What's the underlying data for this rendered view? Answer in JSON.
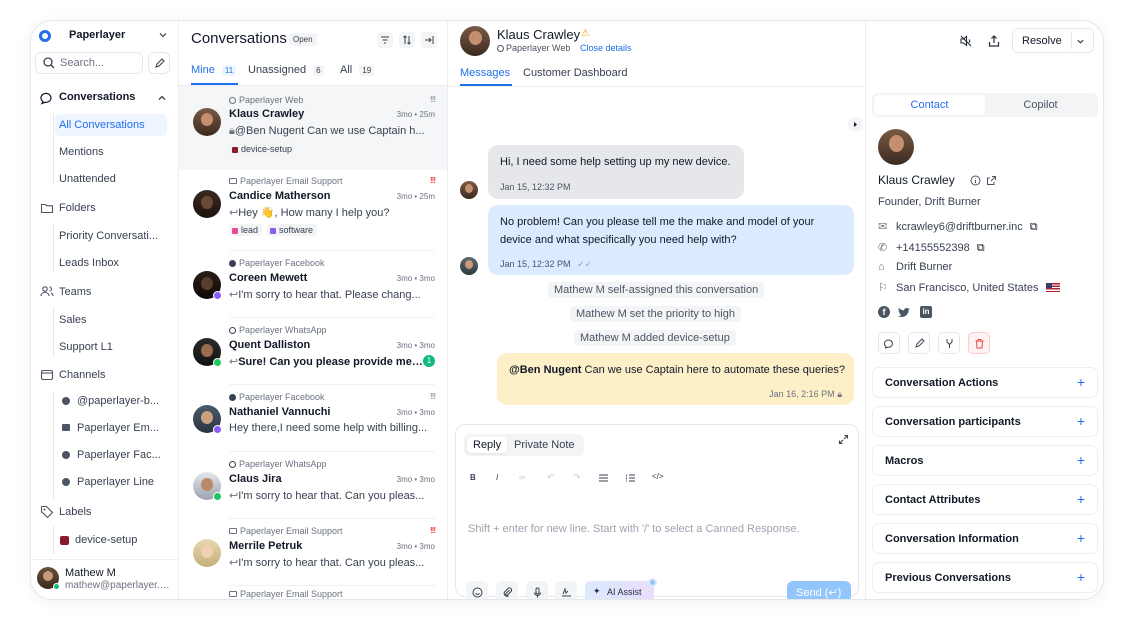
{
  "sidebar": {
    "workspace": "Paperlayer",
    "search_placeholder": "Search...",
    "conversations_label": "Conversations",
    "conv_items": [
      "All Conversations",
      "Mentions",
      "Unattended"
    ],
    "folders_label": "Folders",
    "folder_items": [
      "Priority Conversati...",
      "Leads Inbox"
    ],
    "teams_label": "Teams",
    "team_items": [
      "Sales",
      "Support L1"
    ],
    "channels_label": "Channels",
    "channel_items": [
      "@paperlayer-b...",
      "Paperlayer Em...",
      "Paperlayer Fac...",
      "Paperlayer Line"
    ],
    "labels_label": "Labels",
    "label_items": [
      {
        "name": "device-setup",
        "color": "#8b1a2b"
      }
    ],
    "user": {
      "name": "Mathew M",
      "email": "mathew@paperlayer.c..."
    }
  },
  "list": {
    "title": "Conversations",
    "status_badge": "Open",
    "tabs": [
      {
        "label": "Mine",
        "count": "11"
      },
      {
        "label": "Unassigned",
        "count": "6"
      },
      {
        "label": "All",
        "count": "19"
      }
    ],
    "items": [
      {
        "source": "Paperlayer Web",
        "name": "Klaus Crawley",
        "time": "3mo • 25m",
        "preview": "@Ben Nugent Can we use Captain h...",
        "tags": [
          {
            "name": "device-setup",
            "color": "#8b1a2b"
          }
        ],
        "priority": "!!!"
      },
      {
        "source": "Paperlayer Email Support",
        "name": "Candice Matherson",
        "time": "3mo • 25m",
        "preview": "Hey 👋, How many I help you?",
        "tags": [
          {
            "name": "lead",
            "color": "#ec4899"
          },
          {
            "name": "software",
            "color": "#8b5cf6"
          }
        ],
        "priority": "!!!"
      },
      {
        "source": "Paperlayer Facebook",
        "name": "Coreen Mewett",
        "time": "3mo • 3mo",
        "preview": "I'm sorry to hear that. Please chang..."
      },
      {
        "source": "Paperlayer WhatsApp",
        "name": "Quent Dalliston",
        "time": "3mo • 3mo",
        "preview": "Sure! Can you please provide me wi...",
        "unread": "1"
      },
      {
        "source": "Paperlayer Facebook",
        "name": "Nathaniel Vannuchi",
        "time": "3mo • 3mo",
        "preview": "Hey there,I need some help with billing...",
        "priority": "!!!"
      },
      {
        "source": "Paperlayer WhatsApp",
        "name": "Claus Jira",
        "time": "3mo • 3mo",
        "preview": "I'm sorry to hear that. Can you pleas..."
      },
      {
        "source": "Paperlayer Email Support",
        "name": "Merrile Petruk",
        "time": "3mo • 3mo",
        "preview": "I'm sorry to hear that. Can you pleas...",
        "priority": "!!!"
      },
      {
        "source": "Paperlayer Email Support"
      }
    ]
  },
  "chat": {
    "contact_name": "Klaus Crawley",
    "inbox": "Paperlayer Web",
    "close_details": "Close details",
    "resolve_label": "Resolve",
    "tabs": [
      "Messages",
      "Customer Dashboard"
    ],
    "messages": [
      {
        "text": "Hi, I need some help setting up my new device.",
        "time": "Jan 15, 12:32 PM"
      },
      {
        "text": "No problem! Can you please tell me the make and model of your device and what specifically you need help with?",
        "time": "Jan 15, 12:32 PM"
      }
    ],
    "activities": [
      "Mathew M self-assigned this conversation",
      "Mathew M set the priority to high",
      "Mathew M added device-setup"
    ],
    "private_note": {
      "mention": "@Ben Nugent",
      "text": " Can we use Captain here to automate these queries?",
      "time": "Jan 16, 2:16 PM"
    },
    "composer": {
      "tab_reply": "Reply",
      "tab_note": "Private Note",
      "placeholder": "Shift + enter for new line. Start with '/' to select a Canned Response.",
      "ai_assist": "AI Assist",
      "send": "Send (↵)"
    }
  },
  "info": {
    "tabs": [
      "Contact",
      "Copilot"
    ],
    "name": "Klaus Crawley",
    "title": "Founder, Drift Burner",
    "email": "kcrawley6@driftburner.inc",
    "phone": "+14155552398",
    "company": "Drift Burner",
    "location": "San Francisco, United States",
    "sections": [
      "Conversation Actions",
      "Conversation participants",
      "Macros",
      "Contact Attributes",
      "Conversation Information",
      "Previous Conversations"
    ]
  },
  "colors": {
    "accent": "#1f6feb",
    "outgoing": "#dbeafe",
    "incoming": "#e5e7eb",
    "note": "#fdefc7",
    "danger": "#ef4444"
  }
}
